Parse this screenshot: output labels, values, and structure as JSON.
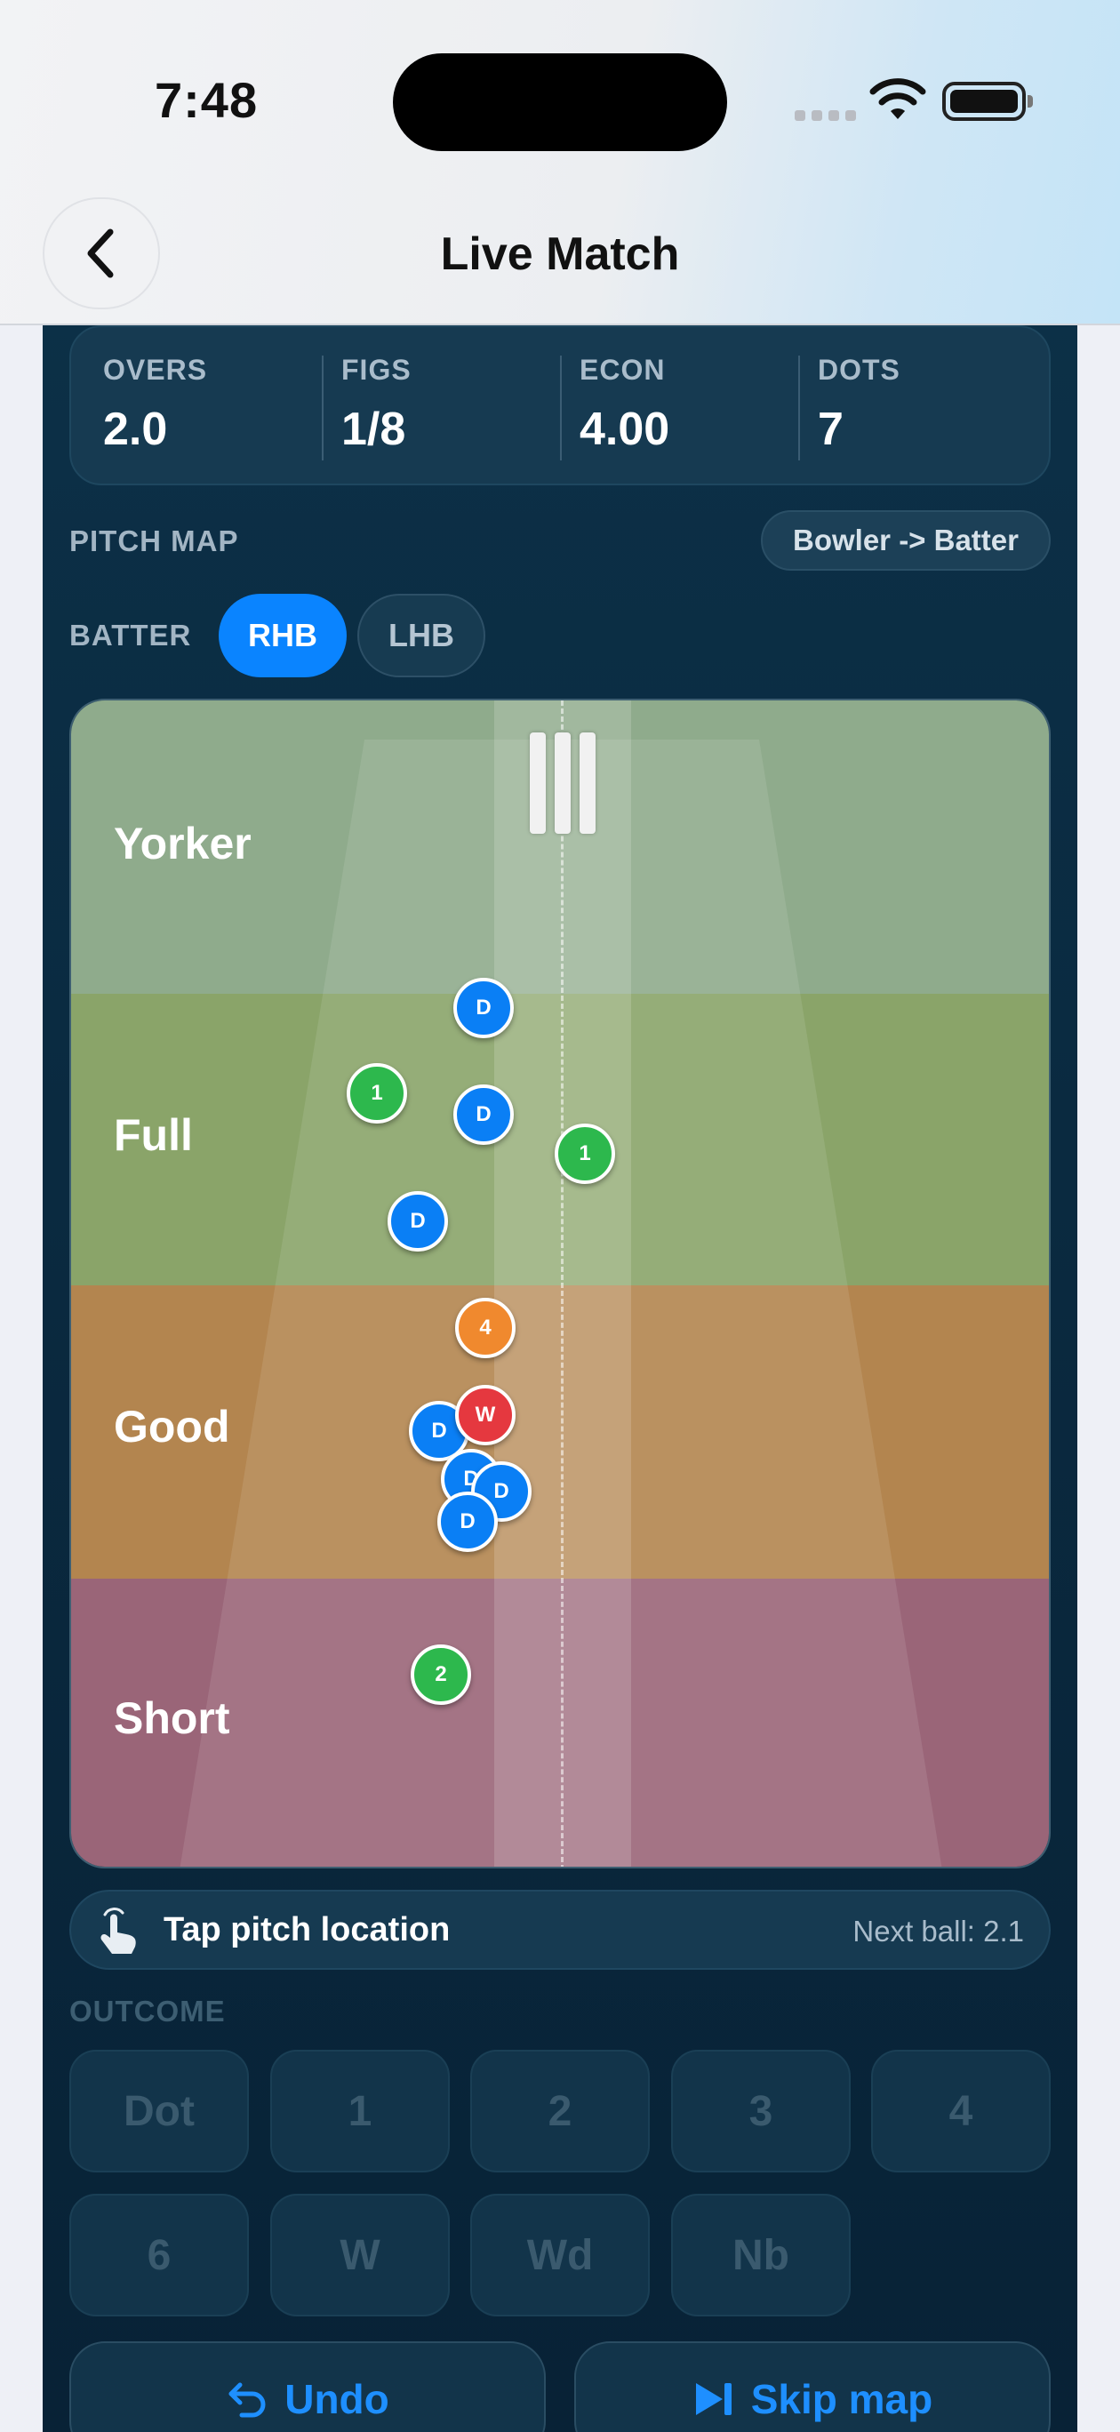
{
  "status_bar": {
    "time": "7:48"
  },
  "nav": {
    "title": "Live Match"
  },
  "stats": [
    {
      "label": "OVERS",
      "value": "2.0"
    },
    {
      "label": "FIGS",
      "value": "1/8"
    },
    {
      "label": "ECON",
      "value": "4.00"
    },
    {
      "label": "DOTS",
      "value": "7"
    }
  ],
  "pitch_map": {
    "label": "PITCH MAP",
    "direction_button": "Bowler -> Batter",
    "batter_label": "BATTER",
    "batter_options": [
      "RHB",
      "LHB"
    ],
    "selected_batter": "RHB",
    "zones": [
      {
        "label": "Yorker",
        "color": "#8fab8c"
      },
      {
        "label": "Full",
        "color": "#8aa469"
      },
      {
        "label": "Good",
        "color": "#b3854f"
      },
      {
        "label": "Short",
        "color": "#9a6578"
      }
    ],
    "balls": [
      {
        "text": "D",
        "kind": "dot"
      },
      {
        "text": "1",
        "kind": "run"
      },
      {
        "text": "D",
        "kind": "dot"
      },
      {
        "text": "1",
        "kind": "run"
      },
      {
        "text": "D",
        "kind": "dot"
      },
      {
        "text": "4",
        "kind": "boundary"
      },
      {
        "text": "D",
        "kind": "dot"
      },
      {
        "text": "W",
        "kind": "wicket"
      },
      {
        "text": "D",
        "kind": "dot"
      },
      {
        "text": "D",
        "kind": "dot"
      },
      {
        "text": "D",
        "kind": "dot"
      },
      {
        "text": "2",
        "kind": "run"
      }
    ],
    "colors": {
      "dot": "#0a7ff5",
      "run": "#2db84d",
      "boundary": "#f0892e",
      "wicket": "#e5383f"
    }
  },
  "tap_hint": {
    "text": "Tap pitch location",
    "next_ball": "Next ball: 2.1"
  },
  "outcome": {
    "label": "OUTCOME",
    "buttons": [
      "Dot",
      "1",
      "2",
      "3",
      "4",
      "6",
      "W",
      "Wd",
      "Nb"
    ]
  },
  "actions": {
    "undo": "Undo",
    "skip": "Skip map"
  }
}
